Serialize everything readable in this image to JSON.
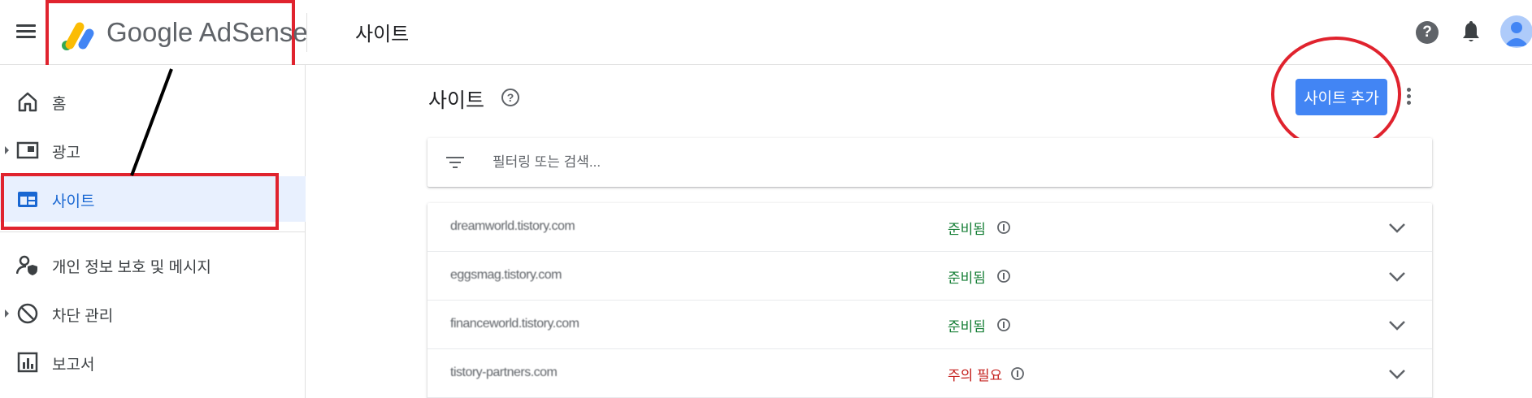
{
  "header": {
    "logo_text": "Google AdSense",
    "title": "사이트"
  },
  "sidebar": {
    "items": [
      {
        "label": "홈",
        "icon": "home-icon"
      },
      {
        "label": "광고",
        "icon": "ads-icon"
      },
      {
        "label": "사이트",
        "icon": "sites-icon"
      },
      {
        "label": "개인 정보 보호 및 메시지",
        "icon": "privacy-messaging-icon"
      },
      {
        "label": "차단 관리",
        "icon": "block-icon"
      },
      {
        "label": "보고서",
        "icon": "reports-icon"
      }
    ],
    "active": "사이트"
  },
  "main": {
    "heading": "사이트",
    "help_glyph": "?",
    "add_site_label": "사이트 추가",
    "filter": {
      "placeholder": "필터링 또는 검색...",
      "value": ""
    },
    "sites": [
      {
        "domain": "dreamworld.tistory.com",
        "status": "준비됨",
        "status_type": "ready"
      },
      {
        "domain": "eggsmag.tistory.com",
        "status": "준비됨",
        "status_type": "ready"
      },
      {
        "domain": "financeworld.tistory.com",
        "status": "준비됨",
        "status_type": "ready"
      },
      {
        "domain": "tistory-partners.com",
        "status": "주의 필요",
        "status_type": "needs-attention"
      }
    ]
  },
  "colors": {
    "accent": "#4285f4",
    "active_bg": "#e8f0fe",
    "active_text": "#1967d2",
    "ready": "#188038",
    "warn": "#c5221f",
    "annotation_red": "#e0232e"
  }
}
